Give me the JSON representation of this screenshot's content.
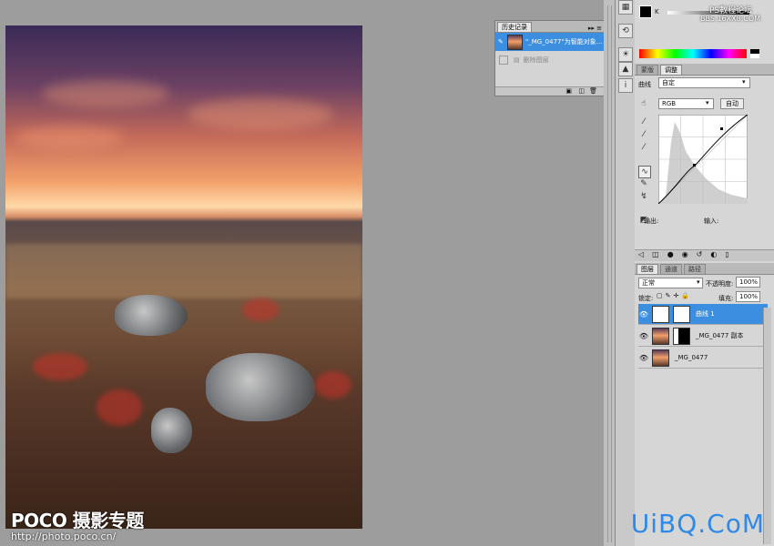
{
  "watermark": {
    "brand": "POCO 摄影专题",
    "url": "http://photo.poco.cn/"
  },
  "site_watermark": "UiBQ.CoM",
  "top_watermark": {
    "line1": "PS教程论坛",
    "line2": "BBS.16XX8.COM"
  },
  "history": {
    "tab": "历史记录",
    "rows": [
      {
        "label": "\"_MG_0477\"为智能对象..."
      },
      {
        "label": "删除图层"
      }
    ]
  },
  "color_panel": {
    "channel_label": "K"
  },
  "adjustments": {
    "tabs": [
      "蒙版",
      "调整"
    ],
    "curve_label": "曲线",
    "preset": "自定",
    "channel": "RGB",
    "auto_button": "自动",
    "output_label": "输出:",
    "input_label": "输入:"
  },
  "layers": {
    "tabs": [
      "图层",
      "通道",
      "路径"
    ],
    "blend_mode": "正常",
    "opacity_label": "不透明度:",
    "opacity_value": "100%",
    "lock_label": "锁定:",
    "fill_label": "填充:",
    "fill_value": "100%",
    "items": [
      {
        "name": "曲线 1"
      },
      {
        "name": "_MG_0477 副本"
      },
      {
        "name": "_MG_0477"
      }
    ]
  },
  "colors": {
    "selection": "#3c8fe0",
    "site": "#2e8ae6"
  }
}
